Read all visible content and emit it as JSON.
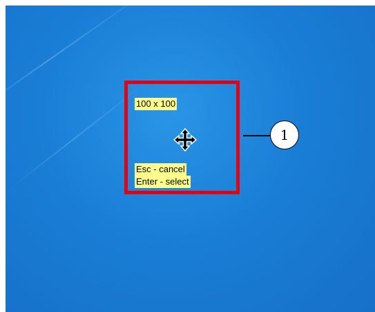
{
  "capture_overlay": {
    "size_label": "100 x 100",
    "hint_cancel": "Esc - cancel",
    "hint_select": "Enter - select",
    "cursor_icon": "move-cursor-icon",
    "frame_color": "#e4000f",
    "label_background": "#ffff8c"
  },
  "callout": {
    "number": "1"
  },
  "desktop": {
    "background_color": "#1a7ed6"
  }
}
